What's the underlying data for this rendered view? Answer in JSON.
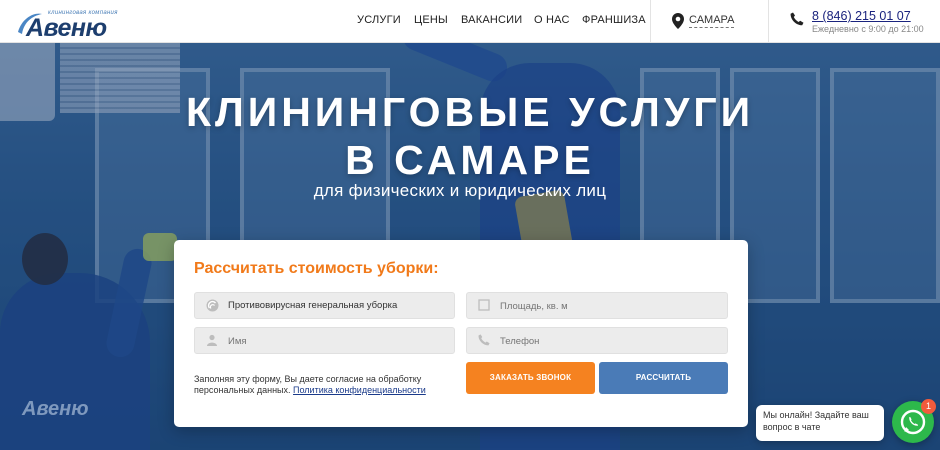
{
  "header": {
    "logo": {
      "sub": "клининговая компания",
      "name": "Авеню"
    },
    "nav": [
      {
        "label": "УСЛУГИ"
      },
      {
        "label": "ЦЕНЫ"
      },
      {
        "label": "ВАКАНСИИ"
      },
      {
        "label": "О НАС"
      },
      {
        "label": "ФРАНШИЗА"
      }
    ],
    "city": "САМАРА",
    "phone": "8 (846) 215 01 07",
    "hours": "Ежедневно с 9:00 до 21:00"
  },
  "hero": {
    "title_line1": "КЛИНИНГОВЫЕ УСЛУГИ",
    "title_line2": "В САМАРЕ",
    "subtitle": "для физических и юридических лиц",
    "shirt_logo": "Авеню"
  },
  "form": {
    "title": "Рассчитать стоимость уборки:",
    "service_value": "Противовирусная генеральная уборка",
    "area_placeholder": "Площадь, кв. м",
    "name_placeholder": "Имя",
    "phone_placeholder": "Телефон",
    "consent_text": "Заполняя эту форму, Вы даете согласие на обработку персональных данных.",
    "policy_link": "Политика конфиденциальности",
    "order_call_button": "ЗАКАЗАТЬ ЗВОНОК",
    "calculate_button": "РАССЧИТАТЬ"
  },
  "chat": {
    "message": "Мы онлайн! Задайте ваш вопрос в чате",
    "badge_count": "1"
  },
  "colors": {
    "accent_orange": "#f58220",
    "button_blue": "#4a7bb7",
    "whatsapp_green": "#2db84b",
    "logo_navy": "#1d3e6e"
  },
  "icons": [
    "location-pin-icon",
    "phone-icon",
    "service-icon",
    "area-icon",
    "user-icon",
    "handset-icon",
    "whatsapp-icon"
  ]
}
